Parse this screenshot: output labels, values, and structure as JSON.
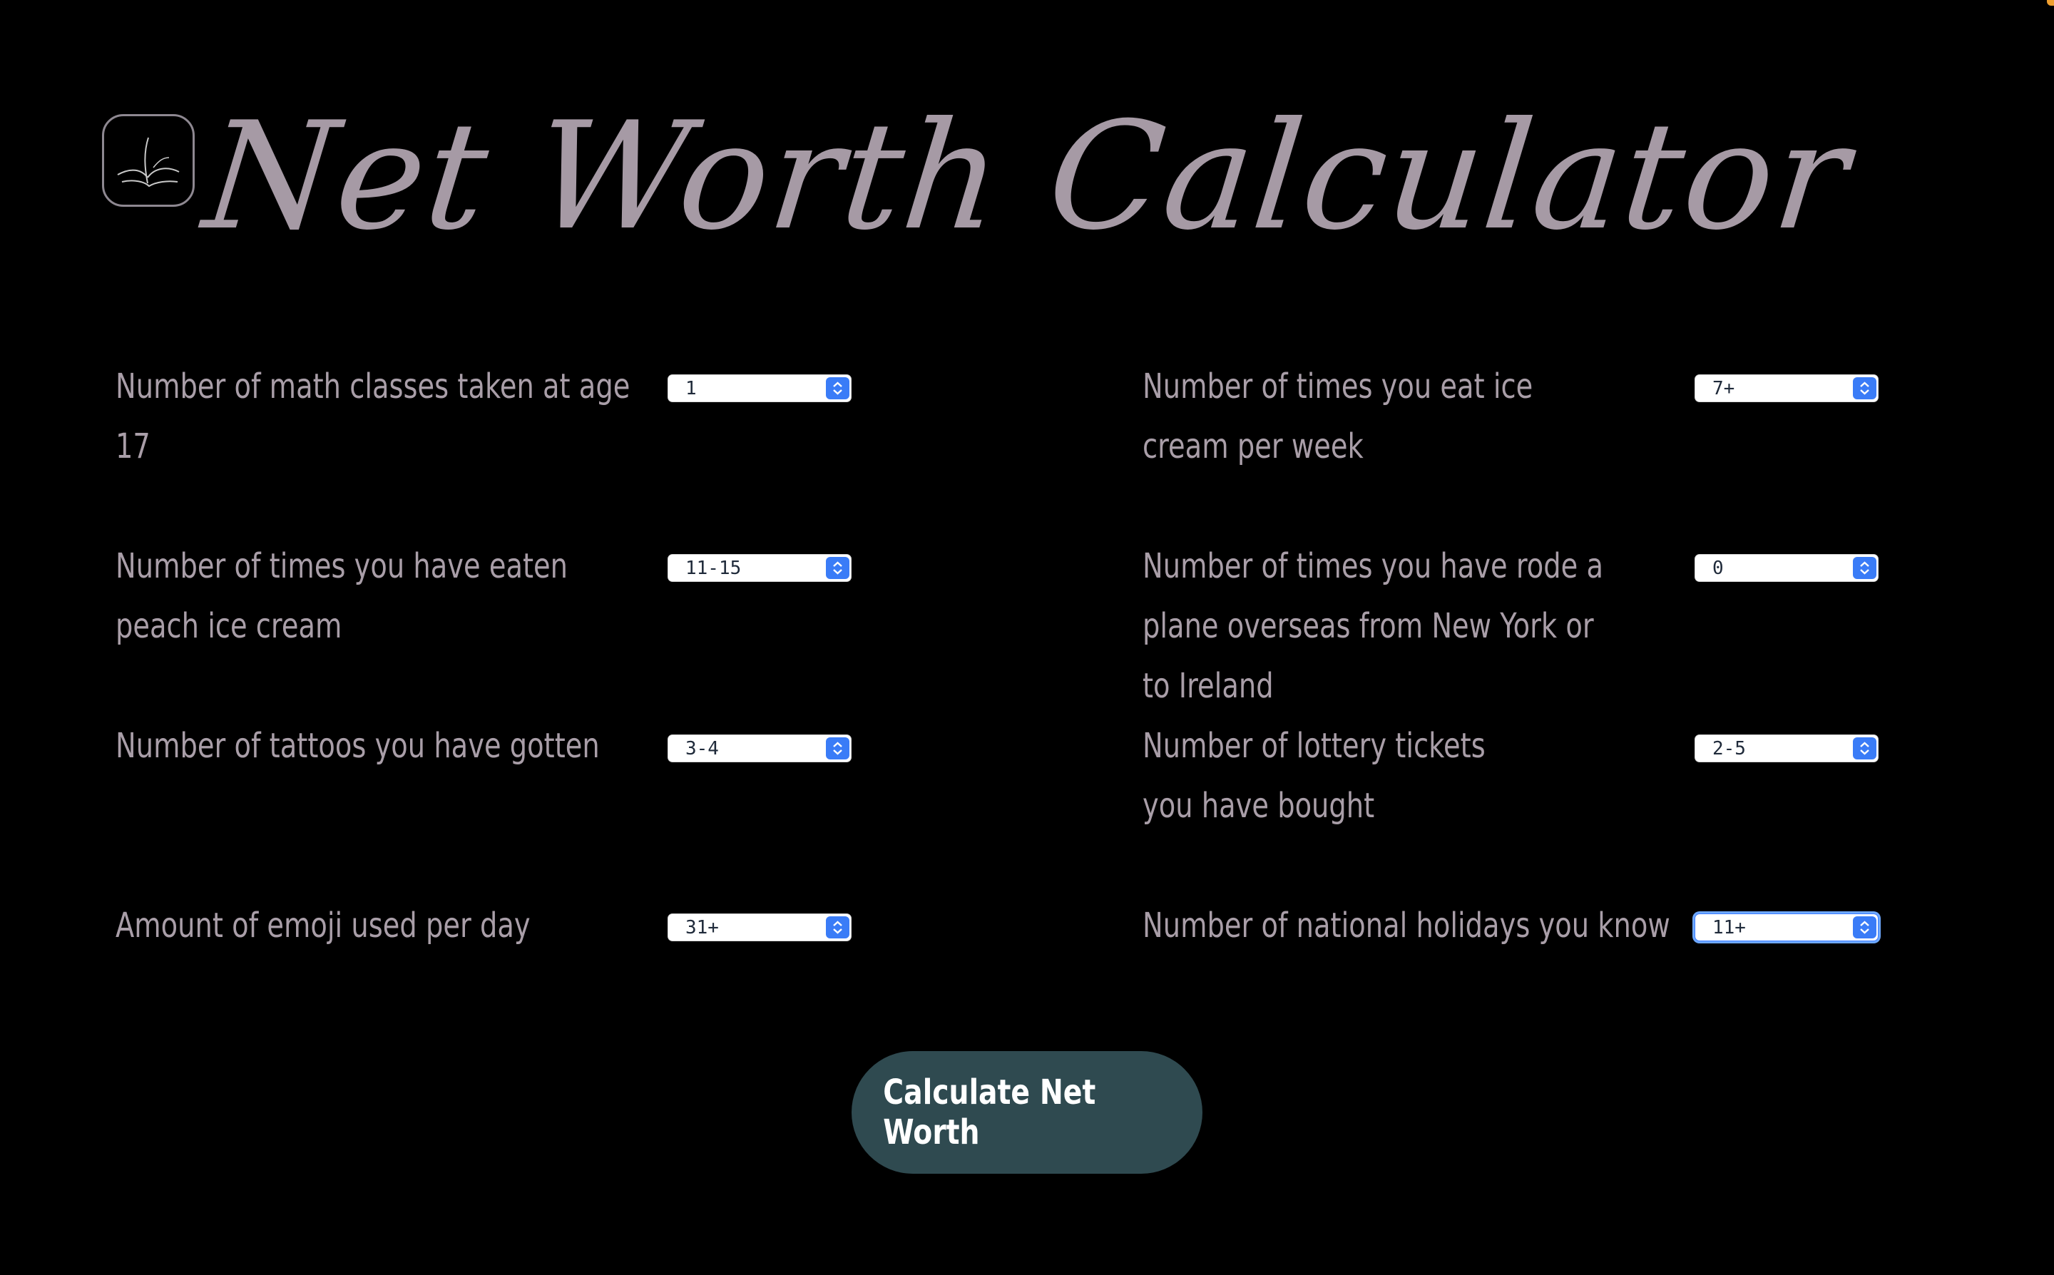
{
  "page": {
    "title": "Net Worth Calculator",
    "logo_icon": "hand-drawn-leaf-logo-icon"
  },
  "fields": [
    {
      "label": "Number of  math classes taken at age 17",
      "value": "1"
    },
    {
      "label": "Number of times you eat ice cream per week",
      "value": "7+"
    },
    {
      "label": "Number of times you have eaten peach ice cream",
      "value": "11-15"
    },
    {
      "label": "Number of times you have rode a plane overseas from New York or to Ireland",
      "value": "0"
    },
    {
      "label": "Number of tattoos you have gotten",
      "value": "3-4"
    },
    {
      "label": "Number of lottery tickets you have bought",
      "value": "2-5"
    },
    {
      "label": "Amount of emoji used per day",
      "value": "31+"
    },
    {
      "label": "Number of national holidays you know",
      "value": "11+"
    }
  ],
  "actions": {
    "calculate_label": "Calculate Net Worth"
  },
  "colors": {
    "background": "#000000",
    "title": "#a69aa5",
    "label": "#a99ea8",
    "button_bg": "#2f4a50",
    "button_text": "#ffffff",
    "select_accent": "#3a7cf7"
  }
}
